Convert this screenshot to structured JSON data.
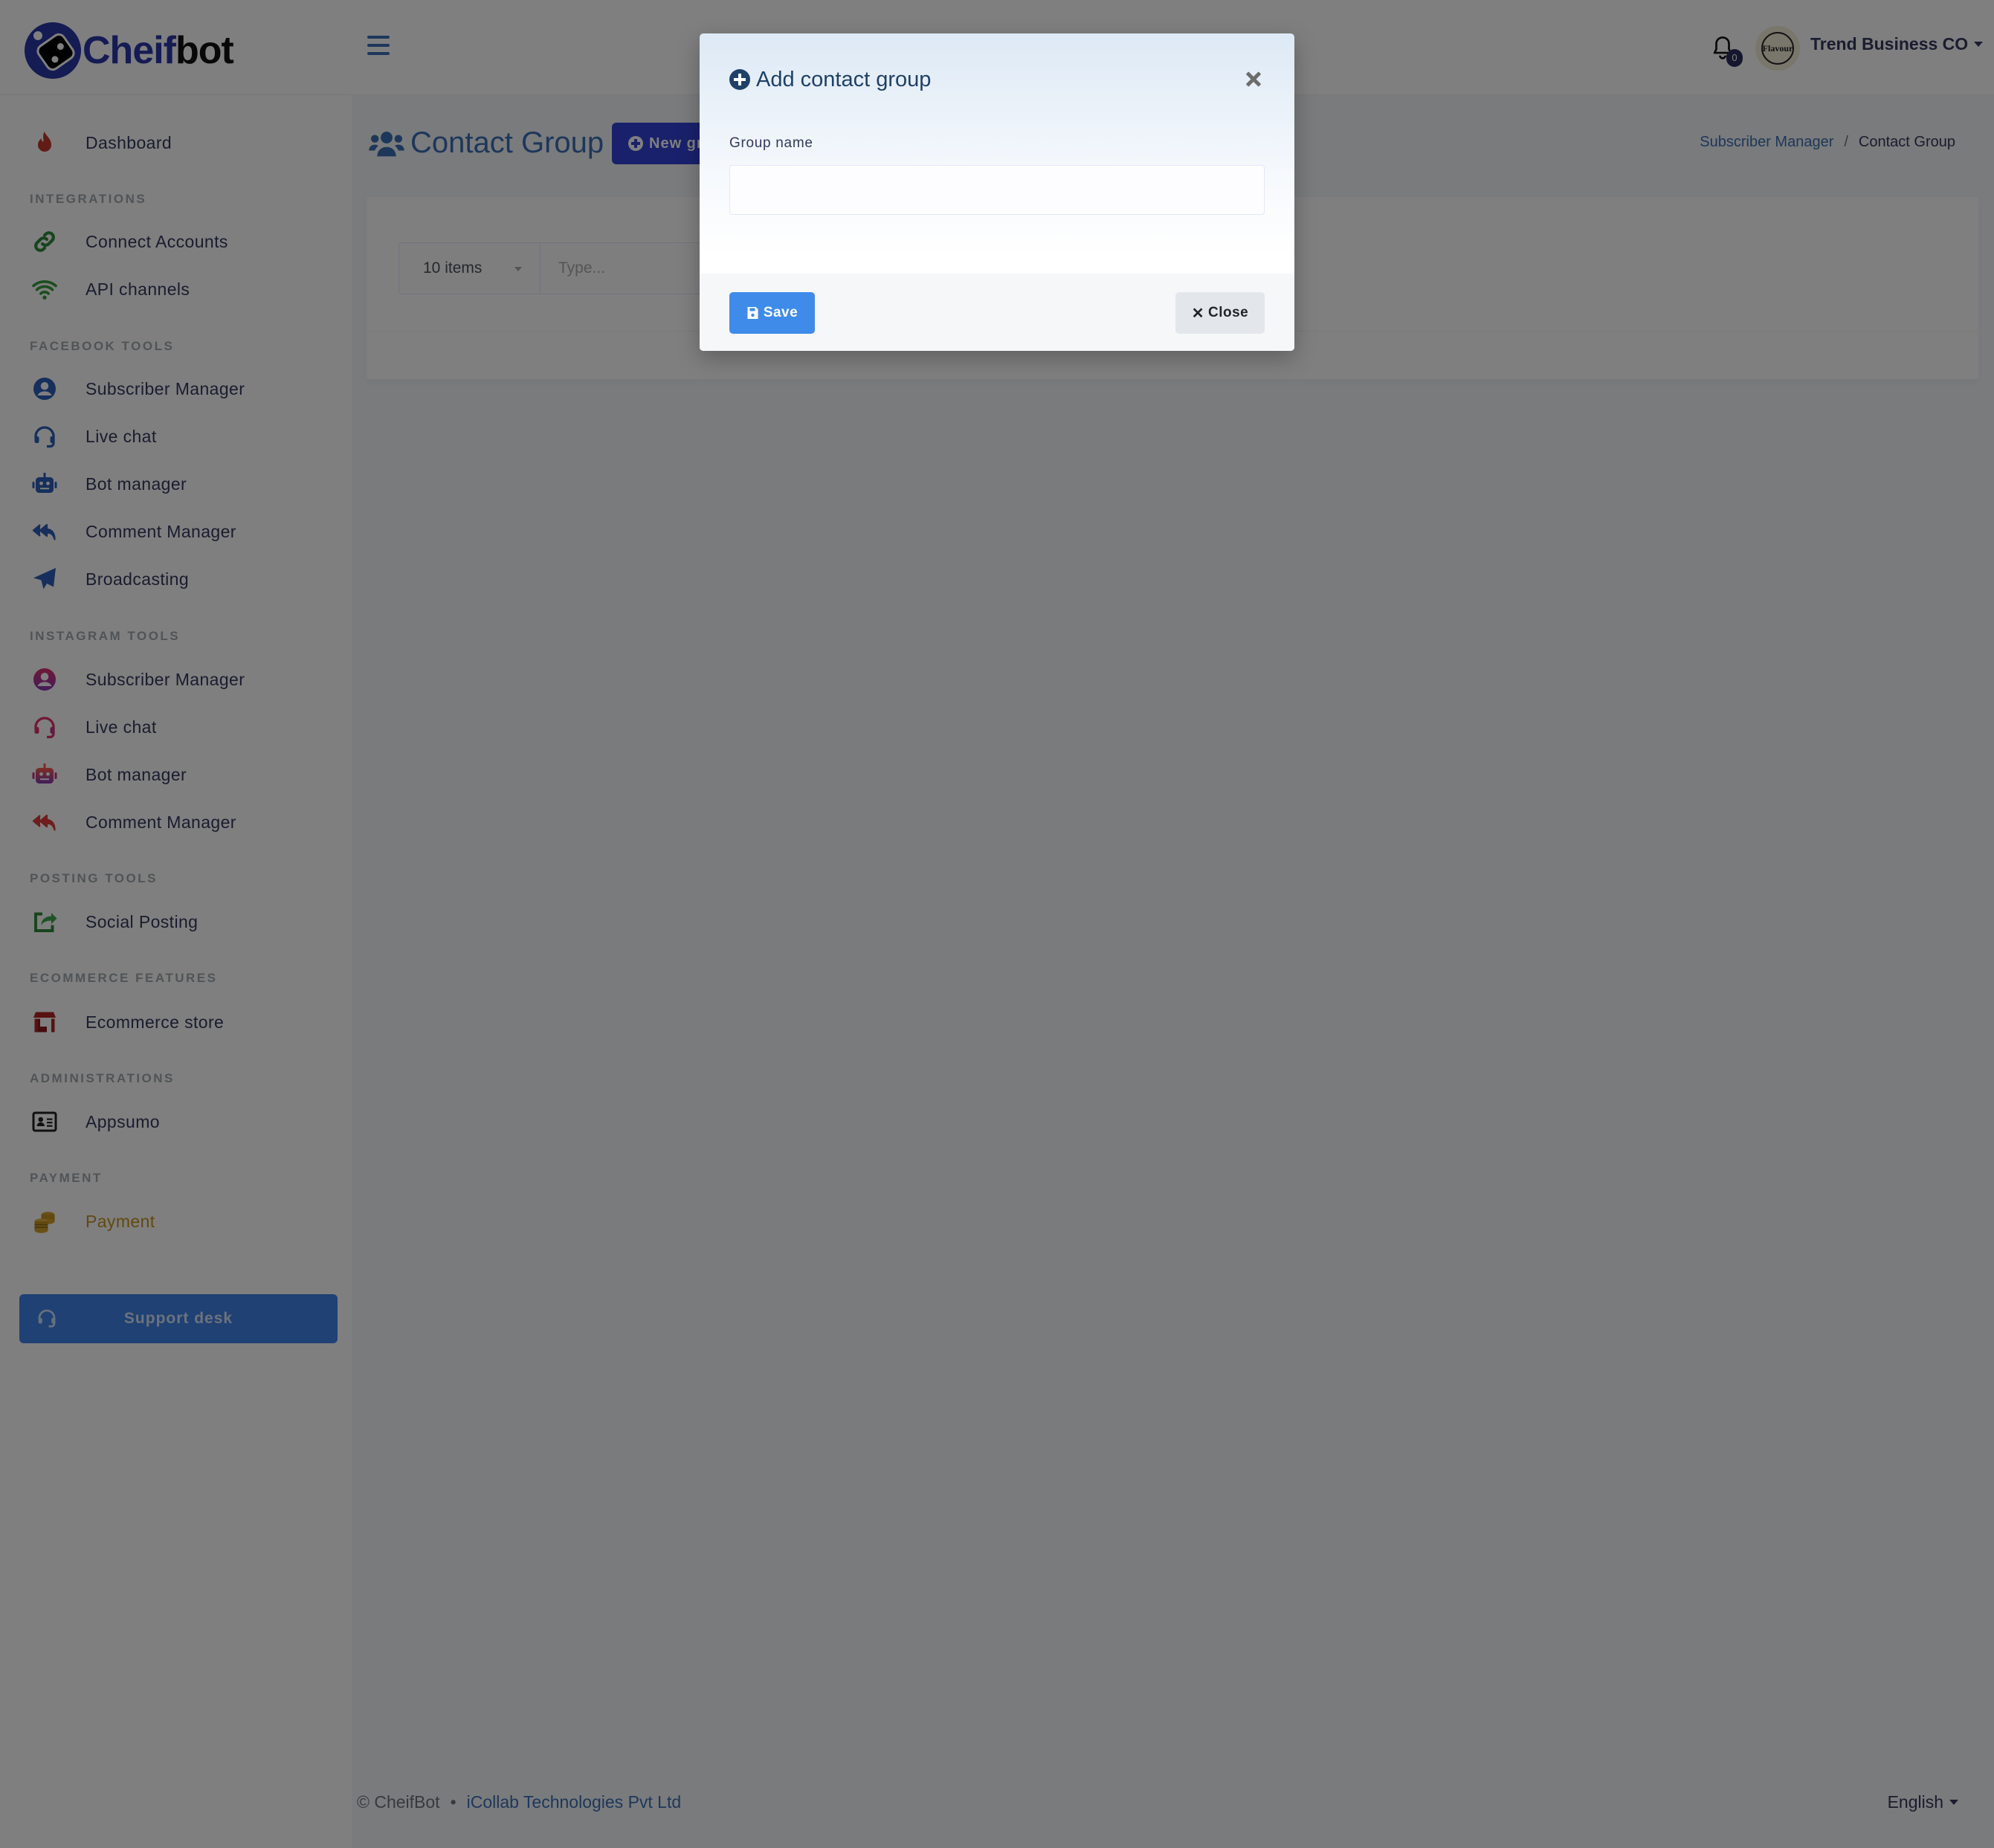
{
  "app": {
    "brand_part1": "Cheif",
    "brand_part2": "bot"
  },
  "header": {
    "notification_count": "0",
    "avatar_text": "Flavour",
    "user_name": "Trend Business CO"
  },
  "sidebar": {
    "dashboard": {
      "label": "Dashboard",
      "icon": "fire-icon"
    },
    "sections": [
      {
        "header": "Integrations",
        "items": [
          {
            "label": "Connect Accounts",
            "icon": "link-icon"
          },
          {
            "label": "API channels",
            "icon": "wifi-icon"
          }
        ]
      },
      {
        "header": "Facebook Tools",
        "items": [
          {
            "label": "Subscriber Manager",
            "icon": "user-circle-icon"
          },
          {
            "label": "Live chat",
            "icon": "headset-icon"
          },
          {
            "label": "Bot manager",
            "icon": "robot-icon"
          },
          {
            "label": "Comment Manager",
            "icon": "reply-all-icon"
          },
          {
            "label": "Broadcasting",
            "icon": "paper-plane-icon"
          }
        ]
      },
      {
        "header": "Instagram Tools",
        "items": [
          {
            "label": "Subscriber Manager",
            "icon": "user-circle-icon"
          },
          {
            "label": "Live chat",
            "icon": "headset-icon"
          },
          {
            "label": "Bot manager",
            "icon": "robot-icon"
          },
          {
            "label": "Comment Manager",
            "icon": "reply-all-icon"
          }
        ]
      },
      {
        "header": "Posting Tools",
        "items": [
          {
            "label": "Social Posting",
            "icon": "share-square-icon"
          }
        ]
      },
      {
        "header": "Ecommerce Features",
        "items": [
          {
            "label": "Ecommerce store",
            "icon": "store-icon"
          }
        ]
      },
      {
        "header": "Administrations",
        "items": [
          {
            "label": "Appsumo",
            "icon": "id-card-icon"
          }
        ]
      },
      {
        "header": "Payment",
        "items": [
          {
            "label": "Payment",
            "icon": "coins-icon"
          }
        ]
      }
    ],
    "support_button": "Support desk"
  },
  "main": {
    "page_title": "Contact Group",
    "new_group_button": "New group",
    "breadcrumb": {
      "parent": "Subscriber Manager",
      "separator": "/",
      "current": "Contact Group"
    },
    "table_controls": {
      "page_size": "10 items",
      "search_placeholder": "Type...",
      "search_value": ""
    }
  },
  "modal": {
    "title": "Add contact group",
    "field_label": "Group name",
    "field_value": "",
    "save_label": "Save",
    "close_label": "Close"
  },
  "footer": {
    "copyright": "© CheifBot",
    "bullet": "•",
    "company": "iCollab Technologies Pvt Ltd",
    "language": "English"
  },
  "colors": {
    "brand_blue": "#2b36a6",
    "link_blue": "#3b6fb6",
    "primary_button": "#3f8bea",
    "new_group_button": "#3342d8",
    "modal_title": "#1f4068",
    "payment_gold": "#c39321",
    "overlay": "rgba(0,0,0,0.5)"
  }
}
